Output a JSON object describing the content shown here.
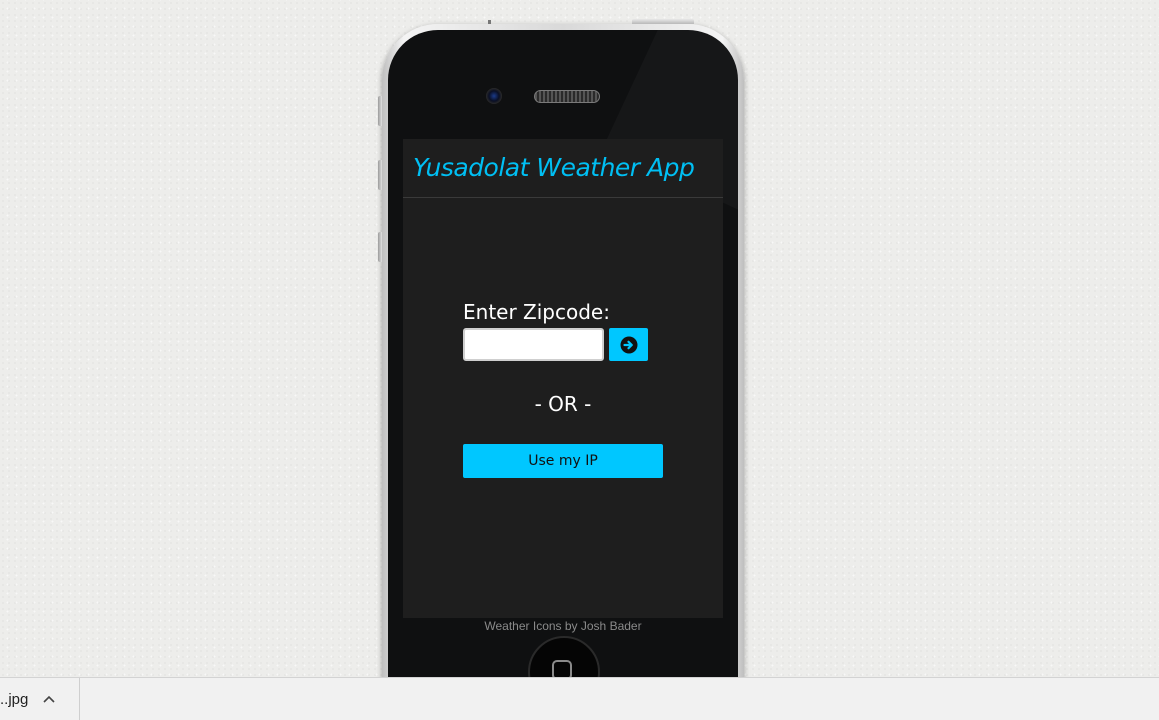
{
  "app": {
    "title": "Yusadolat Weather App",
    "zip_label": "Enter Zipcode:",
    "zip_value": "",
    "zip_placeholder": "",
    "go_icon": "arrow-right-circle-icon",
    "or_text": "- OR -",
    "ip_button_label": "Use my IP",
    "accent_color": "#00c7ff"
  },
  "phone": {
    "credit": "Weather Icons by Josh Bader"
  },
  "download_bar": {
    "file_name": "..jpg",
    "chevron_icon": "chevron-up-icon"
  }
}
